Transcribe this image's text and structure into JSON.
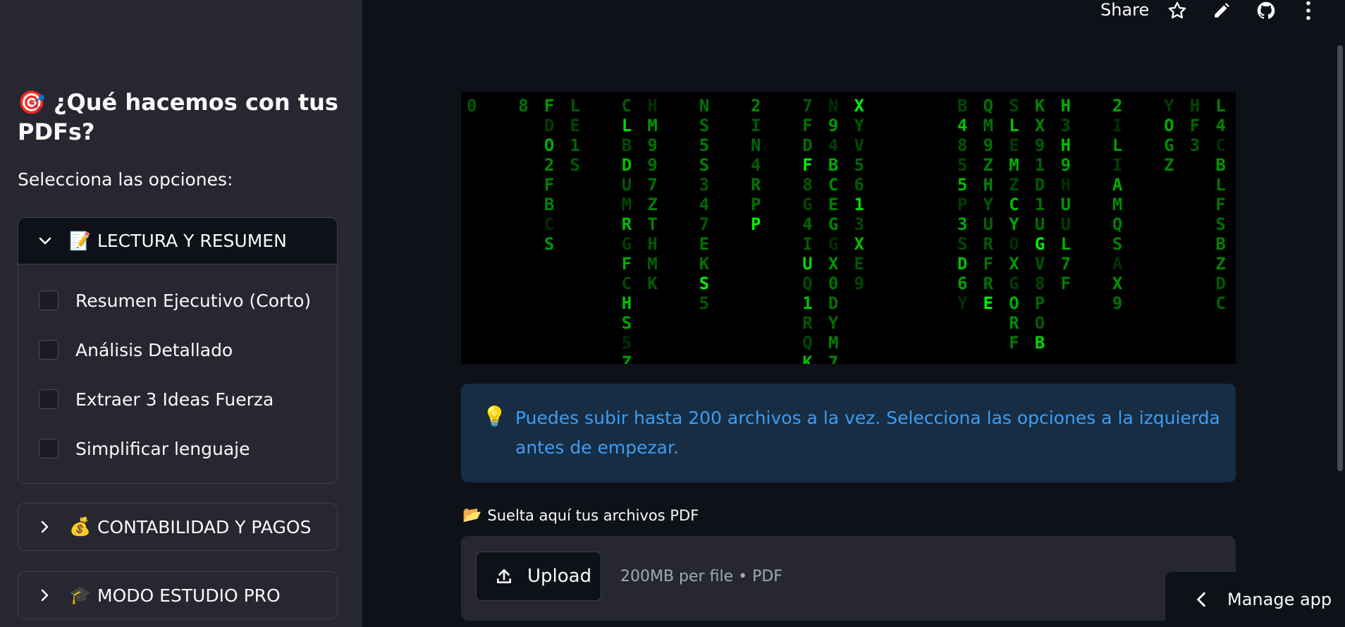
{
  "sidebar": {
    "title": "¿Qué hacemos con tus PDFs?",
    "title_emoji": "🎯",
    "subtitle": "Selecciona las opciones:",
    "expanders": [
      {
        "emoji": "📝",
        "label": "LECTURA Y RESUMEN",
        "open": true,
        "options": [
          "Resumen Ejecutivo (Corto)",
          "Análisis Detallado",
          "Extraer 3 Ideas Fuerza",
          "Simplificar lenguaje"
        ]
      },
      {
        "emoji": "💰",
        "label": "CONTABILIDAD Y PAGOS",
        "open": false
      },
      {
        "emoji": "🎓",
        "label": "MODO ESTUDIO PRO",
        "open": false
      }
    ]
  },
  "header": {
    "share_label": "Share",
    "icons": [
      "star-icon",
      "edit-icon",
      "github-icon",
      "more-vertical-icon"
    ]
  },
  "matrix": {
    "columns": [
      "0                ",
      "                 ",
      "        8        ",
      "F   D  O 2 F B C S",
      "LE1S             ",
      "                 ",
      "C LBDUMRG F CHS5ZA",
      "HM9 9 7 Z T  H M K",
      "                 ",
      "NS5S 3 4 7 E K S 5",
      "                 ",
      "2IN4RPP          ",
      "                 ",
      "7FDF8G4IUQ1RQKZ  ",
      "N94BCEG G X 0DYM 7",
      "XYV 5 6 1 3 X E 9",
      "                 ",
      "                 ",
      "                 ",
      "B 4 8 5 5 P 3 S D 6Y",
      "QM9ZHYU R F R E  ",
      "SLEMZCY OX G O R F",
      "KX91D1U G V 8 P O B",
      "H 3 H 9 H U U L 7 F",
      "                 ",
      "2 I L I A M Q S A X 9",
      "                 ",
      "YOGZ             ",
      "HF3              ",
      "L 4 C B L F S B Z D C"
    ],
    "colors": [
      "#00ff00",
      "#00cc00",
      "#008800"
    ]
  },
  "info": {
    "icon": "💡",
    "text": "Puedes subir hasta 200 archivos a la vez. Selecciona las opciones a la izquierda antes de empezar."
  },
  "uploader": {
    "label_emoji": "📂",
    "label": "Suelta aquí tus archivos PDF",
    "button_label": "Upload",
    "hint": "200MB per file • PDF"
  },
  "manage_app": {
    "label": "Manage app"
  }
}
